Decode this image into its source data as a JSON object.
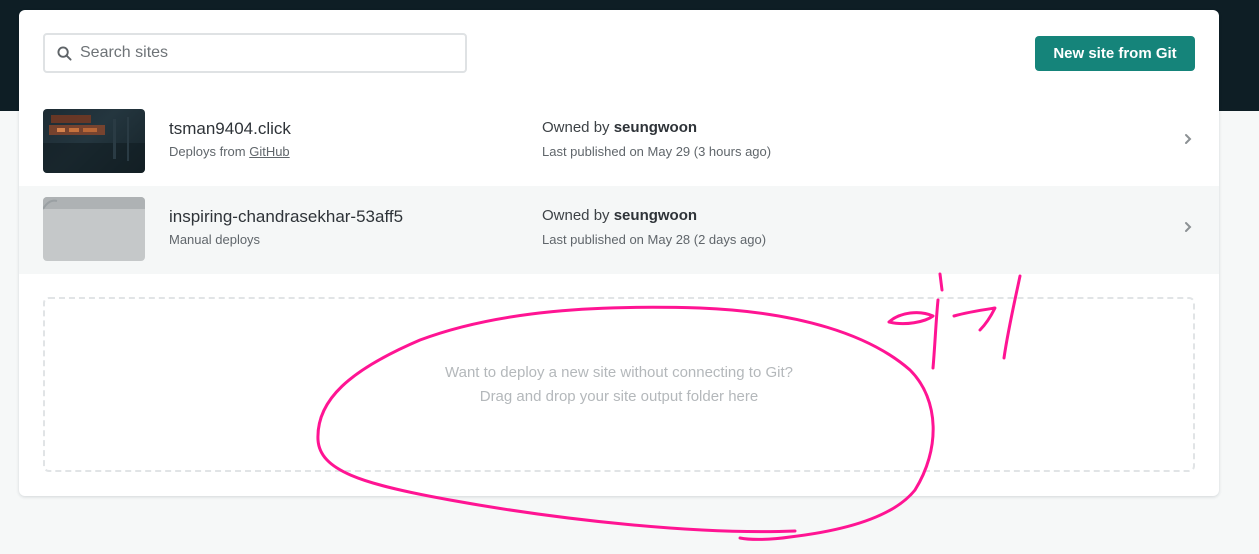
{
  "search": {
    "placeholder": "Search sites",
    "value": "",
    "icon": "search-icon"
  },
  "toolbar": {
    "new_site_label": "New site from Git",
    "accent_color": "#15847a"
  },
  "sites": [
    {
      "name": "tsman9404.click",
      "deploy_prefix": "Deploys from ",
      "deploy_link": "GitHub",
      "owner_prefix": "Owned by ",
      "owner": "seungwoon",
      "published": "Last published on May 29 (3 hours ago)"
    },
    {
      "name": "inspiring-chandrasekhar-53aff5",
      "deploy_prefix": "Manual deploys",
      "deploy_link": "",
      "owner_prefix": "Owned by ",
      "owner": "seungwoon",
      "published": "Last published on May 28 (2 days ago)"
    }
  ],
  "dropzone": {
    "line1": "Want to deploy a new site without connecting to Git?",
    "line2": "Drag and drop your site output folder here"
  },
  "annotation": {
    "color": "#ff1493"
  }
}
